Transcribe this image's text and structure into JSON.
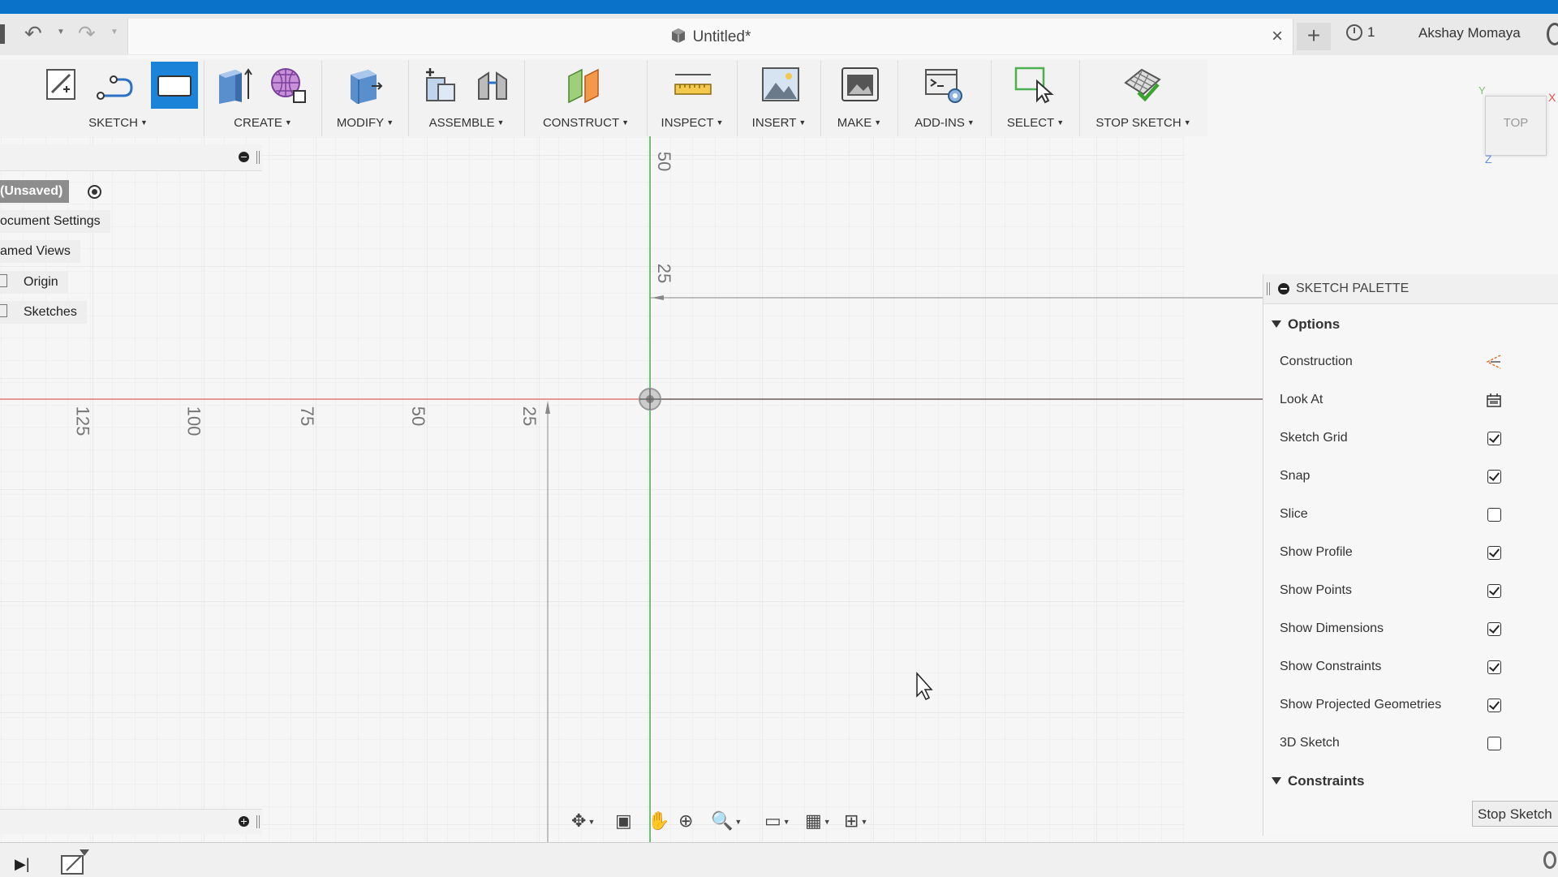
{
  "document": {
    "tab_title": "Untitled*",
    "close": "×"
  },
  "quick_access": {
    "undo": "↶",
    "redo": "↷",
    "dropdown": "▼",
    "new_tab": "+"
  },
  "header": {
    "jobs_count": "1",
    "user_name": "Akshay Momaya"
  },
  "toolbar": {
    "groups": [
      {
        "label": "SKETCH",
        "dd": "▼"
      },
      {
        "label": "CREATE",
        "dd": "▼"
      },
      {
        "label": "MODIFY",
        "dd": "▼"
      },
      {
        "label": "ASSEMBLE",
        "dd": "▼"
      },
      {
        "label": "CONSTRUCT",
        "dd": "▼"
      },
      {
        "label": "INSPECT",
        "dd": "▼"
      },
      {
        "label": "INSERT",
        "dd": "▼"
      },
      {
        "label": "MAKE",
        "dd": "▼"
      },
      {
        "label": "ADD-INS",
        "dd": "▼"
      },
      {
        "label": "SELECT",
        "dd": "▼"
      },
      {
        "label": "STOP SKETCH",
        "dd": "▼"
      }
    ]
  },
  "browser": {
    "items": [
      {
        "label": "(Unsaved)"
      },
      {
        "label": "ocument Settings"
      },
      {
        "label": "amed Views"
      },
      {
        "label": "Origin"
      },
      {
        "label": "Sketches"
      }
    ]
  },
  "canvas": {
    "ruler_x": [
      "125",
      "100",
      "75",
      "50",
      "25"
    ],
    "ruler_y": [
      "50",
      "25"
    ]
  },
  "viewcube": {
    "face": "TOP",
    "x": "X",
    "y": "Y",
    "z": "Z"
  },
  "palette": {
    "title": "SKETCH PALETTE",
    "section_options": "Options",
    "section_constraints": "Constraints",
    "options": [
      {
        "label": "Construction",
        "control": "construction-icon"
      },
      {
        "label": "Look At",
        "control": "look-at-icon"
      },
      {
        "label": "Sketch Grid",
        "checked": true
      },
      {
        "label": "Snap",
        "checked": true
      },
      {
        "label": "Slice",
        "checked": false
      },
      {
        "label": "Show Profile",
        "checked": true
      },
      {
        "label": "Show Points",
        "checked": true
      },
      {
        "label": "Show Dimensions",
        "checked": true
      },
      {
        "label": "Show Constraints",
        "checked": true
      },
      {
        "label": "Show Projected Geometries",
        "checked": true
      },
      {
        "label": "3D Sketch",
        "checked": false
      }
    ],
    "stop_button": "Stop Sketch"
  },
  "navbar": {
    "orbit": "✥",
    "lookat": "▣",
    "pan": "✋",
    "zoom": "⊕",
    "fit": "🔍",
    "display": "▭",
    "grid": "▦",
    "viewports": "⊞",
    "dd": "▼"
  },
  "timeline": {
    "play": "▶|"
  },
  "colors": {
    "accent": "#0b72c9",
    "x_axis": "#e05050",
    "y_axis": "#4caf50",
    "z_axis": "#6a8ee0"
  }
}
